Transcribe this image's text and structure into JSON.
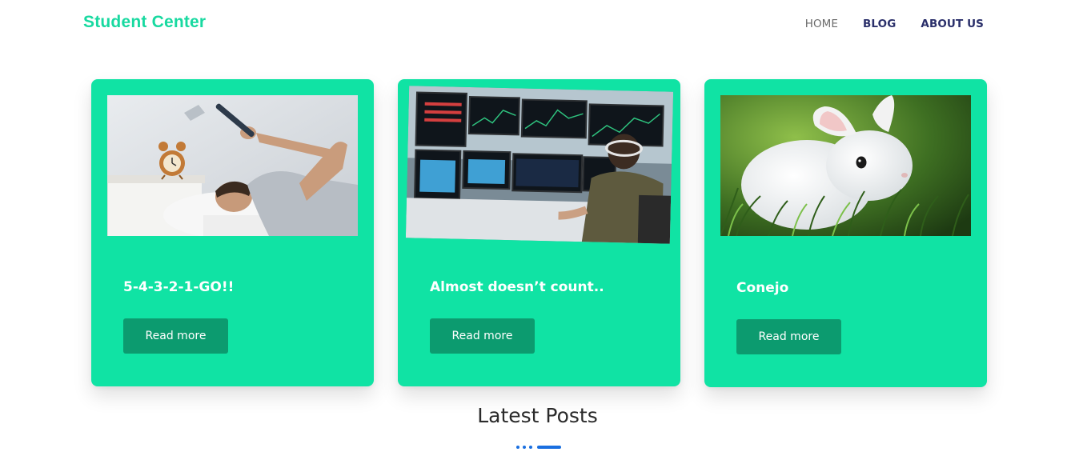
{
  "header": {
    "brand": "Student Center",
    "nav": [
      "HOME",
      "BLOG",
      "ABOUT US"
    ],
    "active_nav": "HOME"
  },
  "cards": [
    {
      "title": "5-4-3-2-1-GO!!",
      "button": "Read more",
      "image": "man-smashing-alarm-clock-photo"
    },
    {
      "title": "Almost doesn’t count..",
      "button": "Read more",
      "image": "trader-at-monitors-photo"
    },
    {
      "title": "Conejo",
      "button": "Read more",
      "image": "white-rabbit-in-grass-photo"
    }
  ],
  "section": {
    "heading": "Latest Posts"
  },
  "colors": {
    "brand": "#18d9a0",
    "card": "#10e3a4",
    "button": "#0c9b6f",
    "accent": "#1a6fe0"
  }
}
